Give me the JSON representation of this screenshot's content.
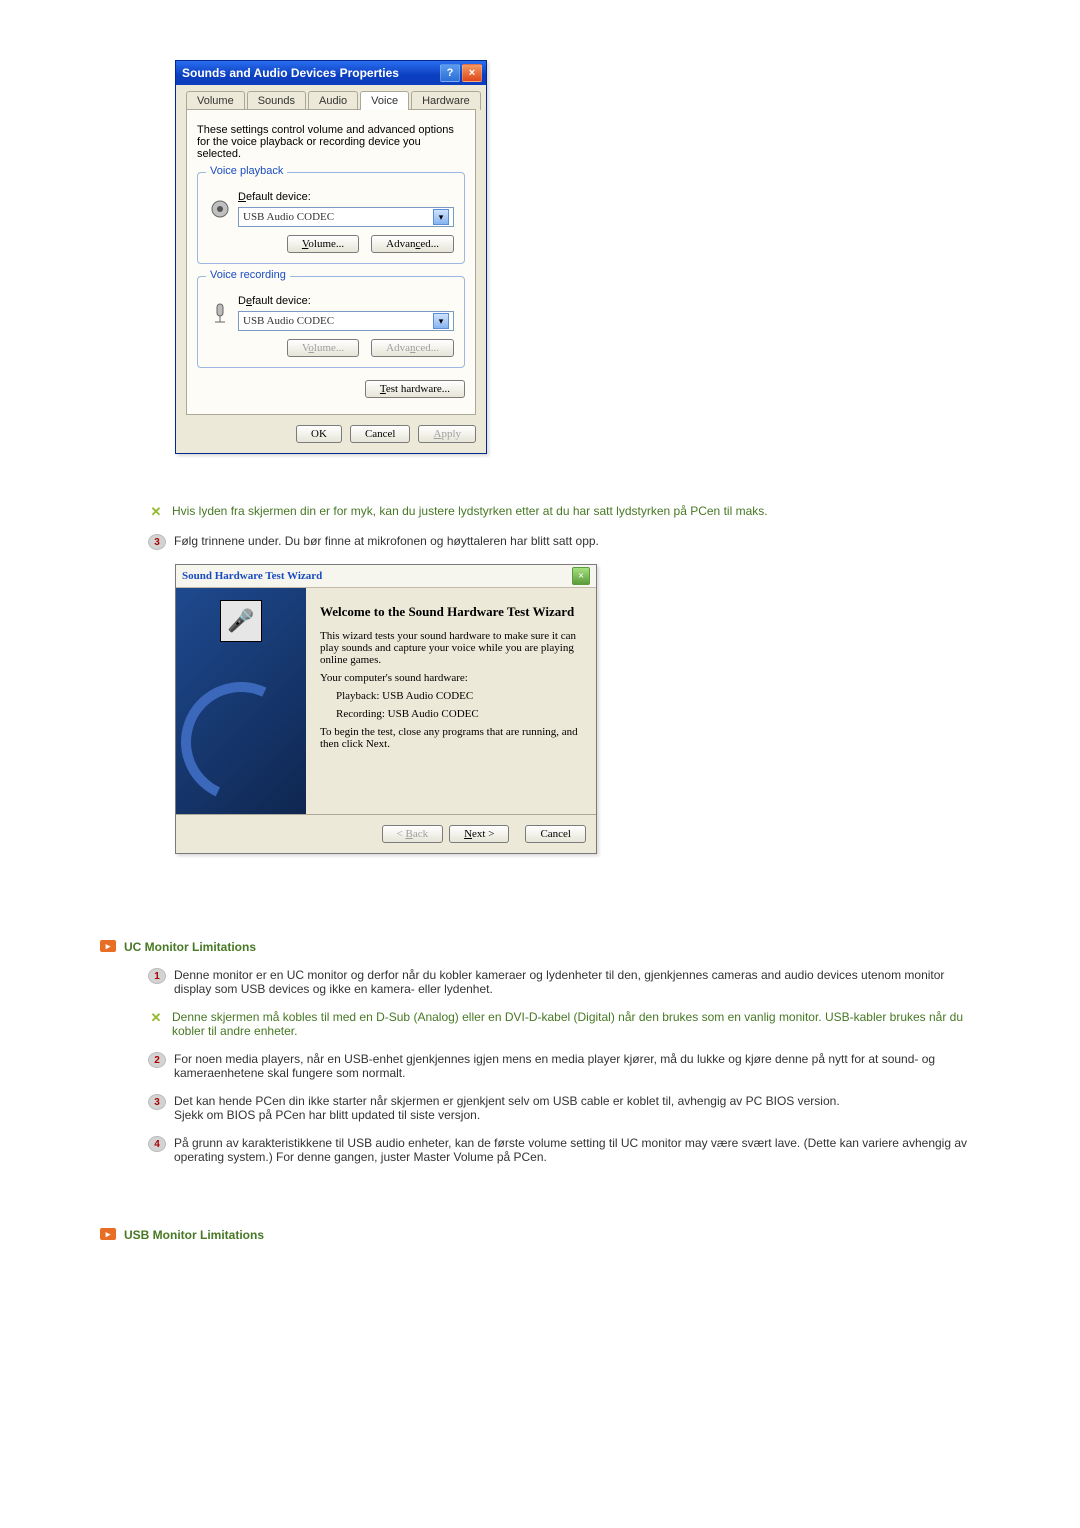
{
  "dialog1": {
    "title": "Sounds and Audio Devices Properties",
    "tabs": [
      "Volume",
      "Sounds",
      "Audio",
      "Voice",
      "Hardware"
    ],
    "activeTab": "Voice",
    "desc": "These settings control volume and advanced options for the voice playback or recording device you selected.",
    "playback": {
      "groupTitle": "Voice playback",
      "label": "Default device:",
      "device": "USB Audio CODEC",
      "volumeBtn": "Volume...",
      "advancedBtn": "Advanced..."
    },
    "recording": {
      "groupTitle": "Voice recording",
      "label": "Default device:",
      "device": "USB Audio CODEC",
      "volumeBtn": "Volume...",
      "advancedBtn": "Advanced..."
    },
    "testBtn": "Test hardware...",
    "ok": "OK",
    "cancel": "Cancel",
    "apply": "Apply"
  },
  "note1": "Hvis lyden fra skjermen din er for myk, kan du justere lydstyrken etter at du har satt lydstyrken på PCen til maks.",
  "step3": "Følg trinnene under. Du bør finne at mikrofonen og høyttaleren har blitt satt opp.",
  "wizard": {
    "title": "Sound Hardware Test Wizard",
    "heading": "Welcome to the Sound Hardware Test Wizard",
    "p1": "This wizard tests your sound hardware to make sure it can play sounds and capture your voice while you are playing online games.",
    "p2": "Your computer's sound hardware:",
    "playback": "Playback: USB Audio CODEC",
    "recording": "Recording: USB Audio CODEC",
    "p3": "To begin the test, close any programs that are running, and then click Next.",
    "back": "< Back",
    "next": "Next >",
    "cancel": "Cancel"
  },
  "section_uc": {
    "heading": "UC Monitor Limitations",
    "item1": "Denne monitor er en UC monitor og derfor når du kobler kameraer og lydenheter til den, gjenkjennes cameras and audio devices utenom monitor display som USB devices og ikke en kamera- eller lydenhet.",
    "note1": "Denne skjermen må kobles til med en D-Sub (Analog) eller en DVI-D-kabel (Digital) når den brukes som en vanlig monitor. USB-kabler brukes når du kobler til andre enheter.",
    "item2": "For noen media players, når en USB-enhet gjenkjennes igjen mens en media player kjører, må du lukke og kjøre denne på nytt for at sound- og kameraenhetene skal fungere som normalt.",
    "item3a": "Det kan hende PCen din ikke starter når skjermen er gjenkjent selv om USB cable er koblet til, avhengig av PC BIOS version.",
    "item3b": "Sjekk om BIOS på PCen har blitt updated til siste versjon.",
    "item4": "På grunn av karakteristikkene til USB audio enheter, kan de første volume setting til UC monitor may være svært lave. (Dette kan variere avhengig av operating system.) For denne gangen, juster Master Volume på PCen."
  },
  "section_usb": {
    "heading": "USB Monitor Limitations"
  }
}
